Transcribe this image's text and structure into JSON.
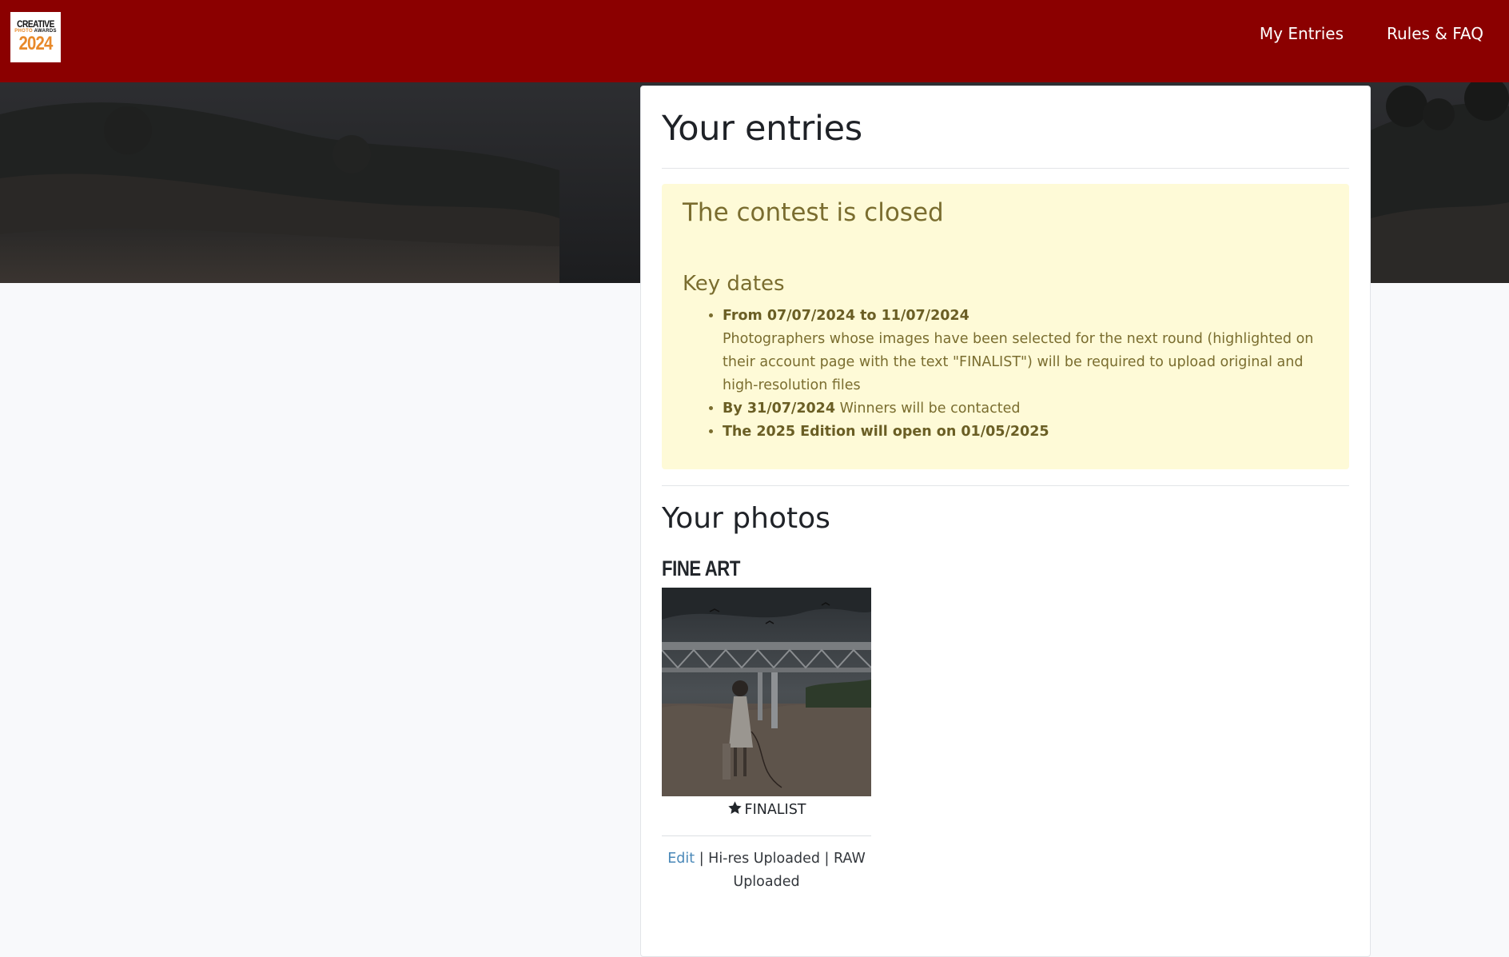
{
  "header": {
    "logo": {
      "line1": "CREATIVE",
      "line2_a": "PHOTO",
      "line2_b": "AWARDS",
      "line3": "2024"
    },
    "nav": [
      {
        "label": "My Entries"
      },
      {
        "label": "Rules & FAQ"
      }
    ],
    "bar_color": "#8b0000"
  },
  "main": {
    "title": "Your entries",
    "alert": {
      "title": "The contest is closed",
      "key_dates_title": "Key dates",
      "dates": [
        {
          "bold": "From 07/07/2024 to 11/07/2024",
          "text": "Photographers whose images have been selected for the next round (highlighted on their account page with the text \"FINALIST\") will be required to upload original and high-resolution files"
        },
        {
          "bold": "By 31/07/2024",
          "text": " Winners will be contacted"
        },
        {
          "bold": "The 2025 Edition will open on 01/05/2025",
          "text": ""
        }
      ],
      "background_color": "#fefad7"
    },
    "photos": {
      "title": "Your photos",
      "category": "FINE ART",
      "entry": {
        "badge_icon": "star-icon",
        "badge": "FINALIST",
        "edit_label": "Edit",
        "sep1": " | ",
        "hires_status": "Hi-res Uploaded",
        "sep2": " | ",
        "raw_status": "RAW Uploaded"
      }
    }
  }
}
